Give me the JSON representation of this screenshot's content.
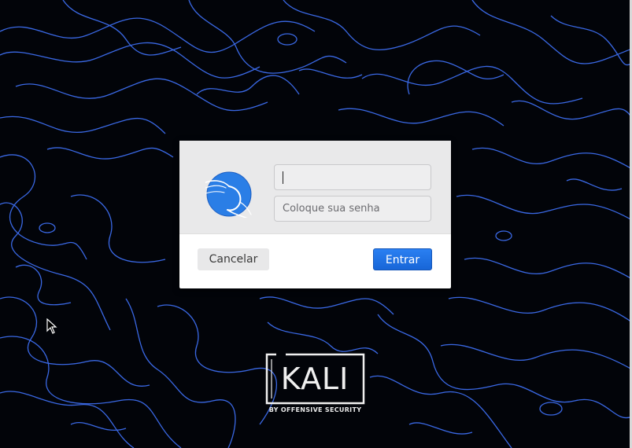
{
  "login_dialog": {
    "username_value": "",
    "password_placeholder": "Coloque sua senha",
    "cancel_label": "Cancelar",
    "login_label": "Entrar"
  },
  "branding": {
    "logo_text": "KALI",
    "tagline": "BY OFFENSIVE SECURITY"
  },
  "icons": {
    "avatar": "kali-dragon-avatar-icon",
    "cursor": "mouse-pointer-icon"
  },
  "colors": {
    "wallpaper_bg": "#020409",
    "contour_lines": "#3d6ef0",
    "dialog_bg": "#ffffff",
    "dialog_header_bg": "#e9e9ea",
    "accent_button": "#1a73e8",
    "avatar_blue": "#2a7ee6"
  }
}
